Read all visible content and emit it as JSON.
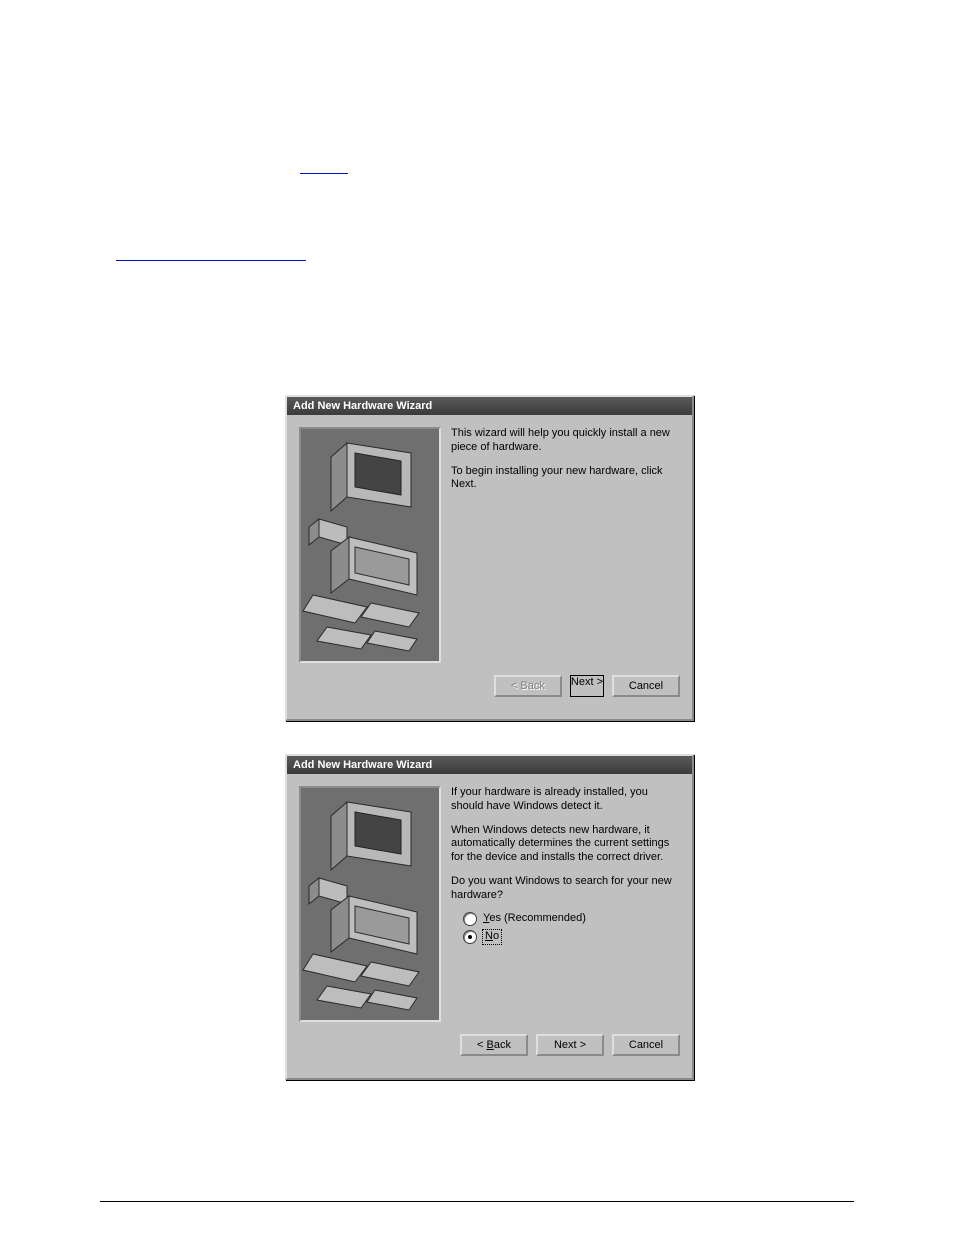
{
  "dialog1": {
    "title": "Add New Hardware Wizard",
    "para1": "This wizard will help you quickly install a new piece of hardware.",
    "para2": "To begin installing your new hardware, click Next.",
    "back": "< Back",
    "next": "Next >",
    "cancel": "Cancel"
  },
  "dialog2": {
    "title": "Add New Hardware Wizard",
    "para1": "If your hardware is already installed, you should have Windows detect it.",
    "para2": "When Windows detects new hardware, it automatically determines the current settings for the device and installs the correct driver.",
    "para3": "Do you want Windows to search for your new hardware?",
    "opt_yes_mn": "Y",
    "opt_yes_rest": "es (Recommended)",
    "opt_no_mn": "N",
    "opt_no_rest": "o",
    "back_mn": "B",
    "back_pre": "< ",
    "back_post": "ack",
    "next": "Next >",
    "cancel": "Cancel"
  }
}
